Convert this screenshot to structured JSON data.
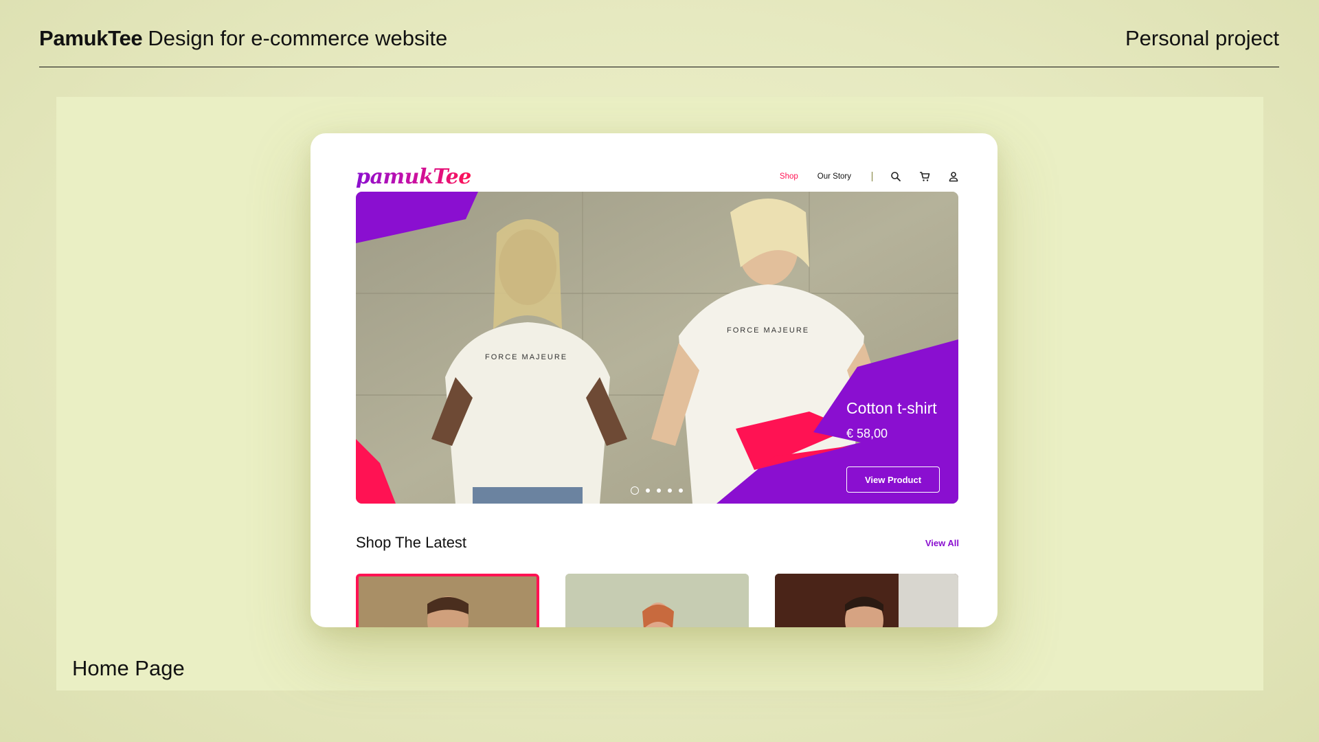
{
  "header": {
    "brand": "PamukTee",
    "subtitle": "Design for e-commerce website",
    "project": "Personal project"
  },
  "page_label": "Home Page",
  "site": {
    "logo": "pamukTee",
    "nav": [
      {
        "label": "Shop",
        "active": true
      },
      {
        "label": "Our Story",
        "active": false
      }
    ],
    "icons": [
      "search-icon",
      "cart-icon",
      "user-icon"
    ],
    "hero": {
      "title": "Cotton t-shirt",
      "price": "€ 58,00",
      "button": "View Product",
      "slides": 5,
      "active_slide": 1,
      "tshirt_print": "FORCE MAJEURE"
    },
    "section": {
      "title": "Shop The Latest",
      "link": "View All"
    },
    "products": [
      "product-1",
      "product-2",
      "product-3"
    ]
  },
  "colors": {
    "accent_purple": "#8a0fd0",
    "accent_pink": "#ff1253",
    "background": "#e6e9c0"
  }
}
